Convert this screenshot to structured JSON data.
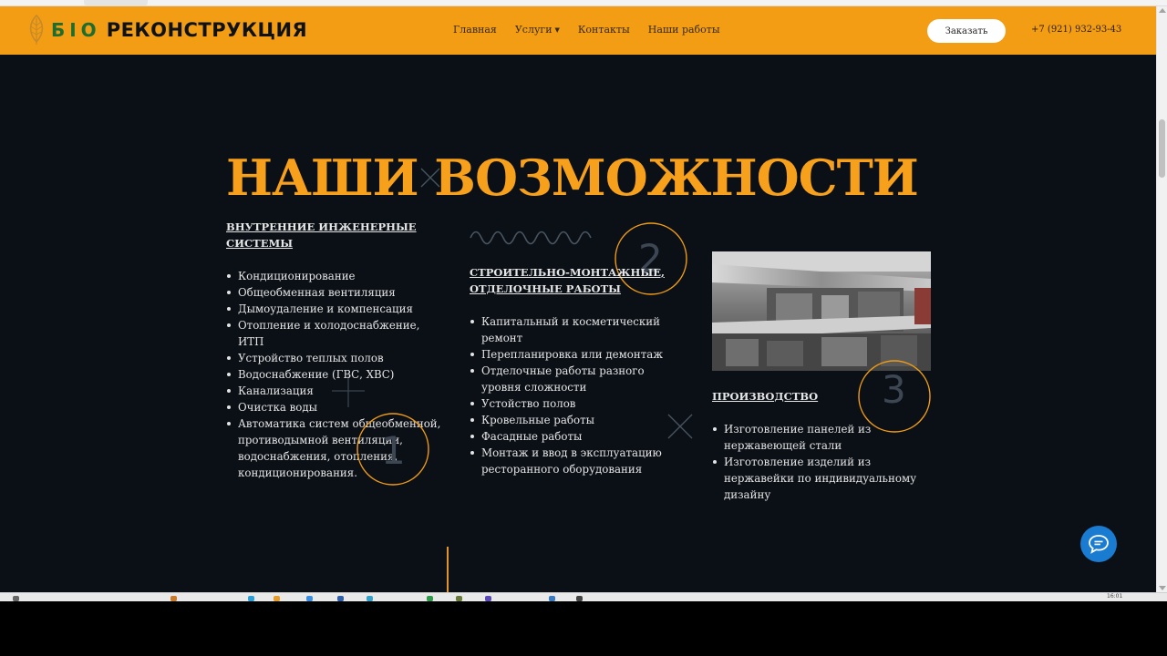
{
  "header": {
    "logo": {
      "bio": "БIО",
      "name": "РЕКОНСТРУКЦИЯ"
    },
    "nav": [
      {
        "label": "Главная"
      },
      {
        "label": "Услуги",
        "has_dropdown": true
      },
      {
        "label": "Контакты"
      },
      {
        "label": "Наши работы"
      }
    ],
    "order_button": "Заказать",
    "phone": "+7 (921) 932-93-43"
  },
  "section": {
    "title": "НАШИ ВОЗМОЖНОСТИ",
    "columns": [
      {
        "number": "1",
        "heading": [
          "ВНУТРЕННИЕ ИНЖЕНЕРНЫЕ",
          "СИСТЕМЫ"
        ],
        "items": [
          "Кондиционирование",
          "Общеобменная вентиляция",
          "Дымоудаление и компенсация",
          "Отопление и холодоснабжение, ИТП",
          "Устройство теплых полов",
          "Водоснабжение (ГВС, ХВС)",
          "Канализация",
          "Очистка воды",
          "Автоматика систем общеобменной, противодымной вентиляции, водоснабжения, отопления, кондиционирования."
        ]
      },
      {
        "number": "2",
        "heading": [
          "СТРОИТЕЛЬНО-МОНТАЖНЫЕ,",
          "ОТДЕЛОЧНЫЕ РАБОТЫ"
        ],
        "items": [
          "Капитальный и косметический ремонт",
          "Перепланировка или демонтаж",
          "Отделочные работы разного уровня сложности",
          "Устойство полов",
          "Кровельные работы",
          "Фасадные работы",
          "Монтаж и ввод в эксплуатацию ресторанного оборудования"
        ]
      },
      {
        "number": "3",
        "heading": [
          "ПРОИЗВОДСТВО"
        ],
        "items": [
          "Изготовление панелей из нержавеющей стали",
          "Изготовление изделий из нержавейки по индивидуальному дизайну"
        ]
      }
    ]
  },
  "taskbar": {
    "clock": "16:01"
  },
  "colors": {
    "accent": "#f29d13",
    "title": "#f7a01b",
    "background": "#0b1017",
    "chat": "#1a7cd1"
  },
  "icons": [
    "leaf-logo-icon",
    "chevron-down-icon",
    "chat-bubble-icon",
    "wave-decoration",
    "cross-decoration"
  ]
}
